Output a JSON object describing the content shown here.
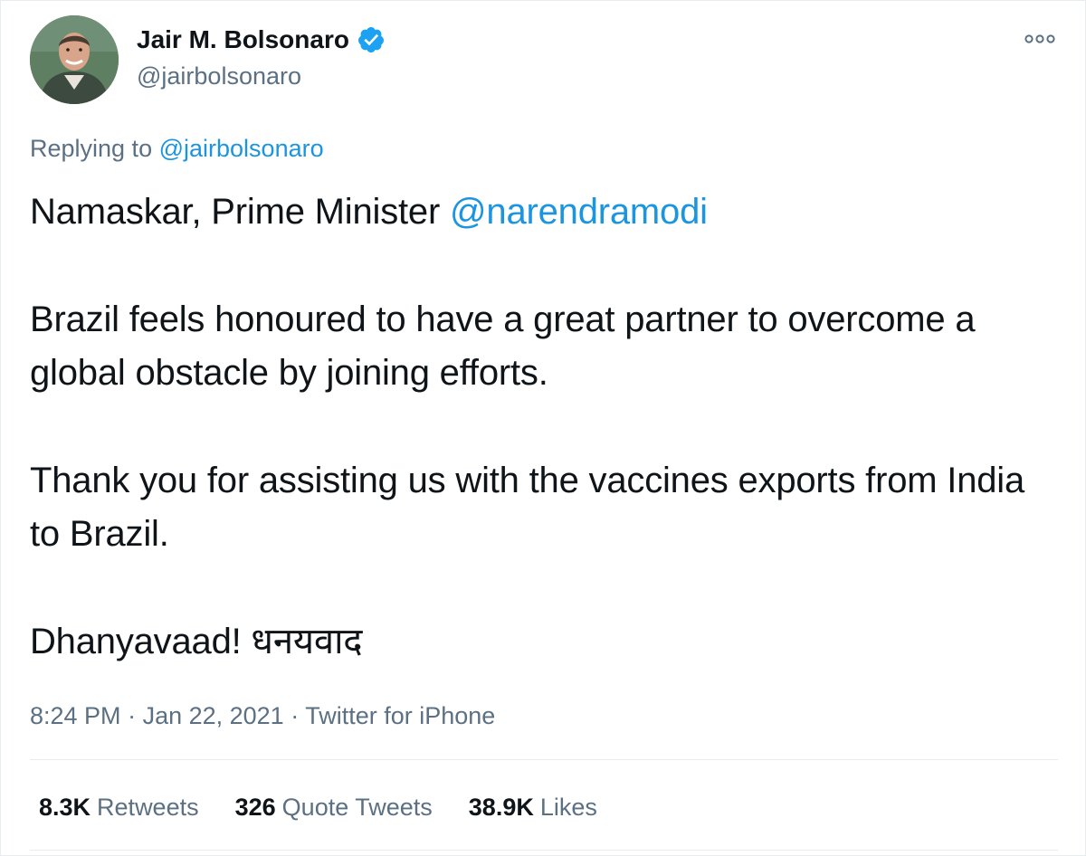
{
  "author": {
    "display_name": "Jair M. Bolsonaro",
    "handle": "@jairbolsonaro",
    "verified": true,
    "avatar_icon": "profile-photo"
  },
  "reply": {
    "prefix": "Replying to",
    "to_handle": "@jairbolsonaro"
  },
  "tweet": {
    "line1_prefix": "Namaskar, Prime Minister ",
    "line1_mention": "@narendramodi",
    "para2": "Brazil feels honoured to have a great partner to overcome a global obstacle by joining efforts.",
    "para3": "Thank you for assisting us with the vaccines exports from India to Brazil.",
    "para4": "Dhanyavaad! धनयवाद"
  },
  "meta": {
    "time": "8:24 PM",
    "separator1": " · ",
    "date": "Jan 22, 2021",
    "separator2": " · ",
    "source": "Twitter for iPhone"
  },
  "stats": {
    "retweets_count": "8.3K",
    "retweets_label": "Retweets",
    "quotes_count": "326",
    "quotes_label": "Quote Tweets",
    "likes_count": "38.9K",
    "likes_label": "Likes"
  },
  "colors": {
    "link": "#1b95e0",
    "muted": "#5b7083",
    "text": "#0f1419",
    "verified": "#1da1f2"
  },
  "icons": {
    "verified": "verified-badge-icon",
    "more": "more-options-icon"
  }
}
